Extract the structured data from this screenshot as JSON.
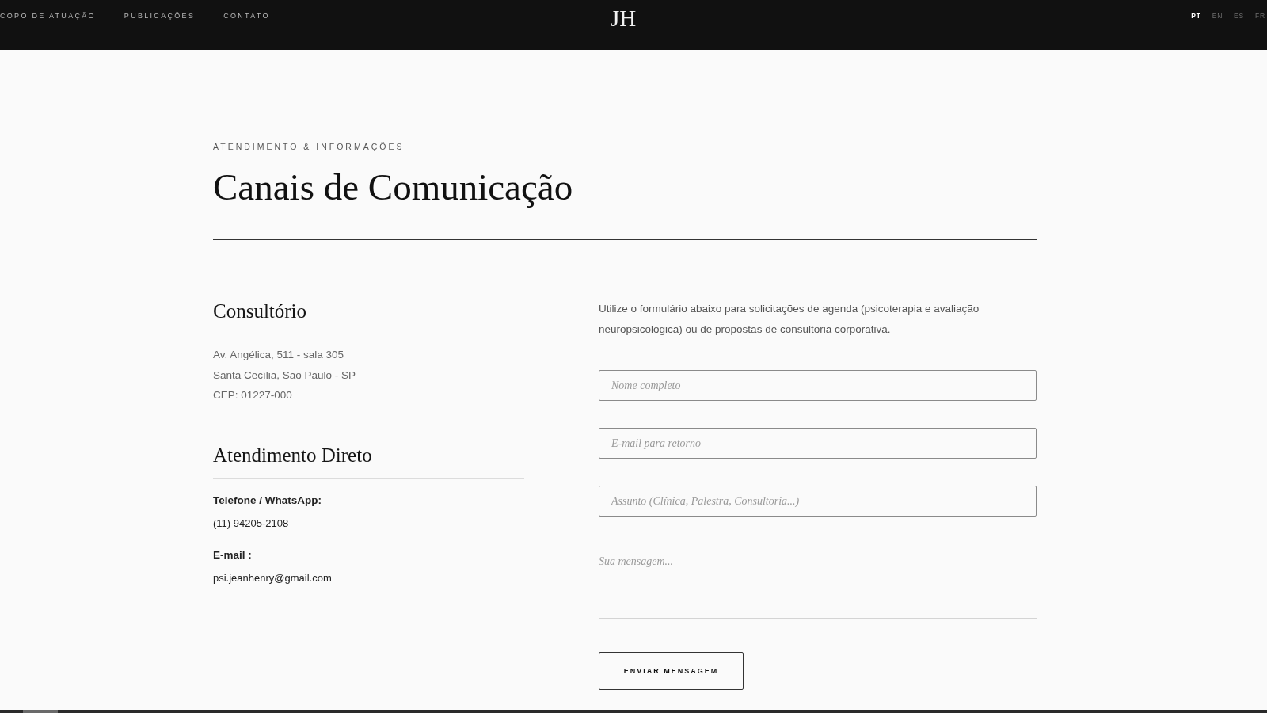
{
  "nav": {
    "links": [
      "COPO DE ATUAÇÃO",
      "PUBLICAÇÕES",
      "CONTATO"
    ],
    "logo": "JH",
    "languages": [
      {
        "label": "PT",
        "selected": true
      },
      {
        "label": "EN",
        "selected": false
      },
      {
        "label": "ES",
        "selected": false
      },
      {
        "label": "FR",
        "selected": false
      }
    ]
  },
  "header": {
    "eyebrow": "ATENDIMENTO & INFORMAÇÕES",
    "title": "Canais de Comunicação"
  },
  "info": {
    "sections": [
      {
        "kind": "address",
        "title": "Consultório",
        "lines": [
          "Av. Angélica, 511 - sala 305",
          "Santa Cecília, São Paulo - SP",
          "CEP: 01227-000"
        ]
      },
      {
        "kind": "contacts",
        "title": "Atendimento Direto",
        "items": [
          {
            "label": "Telefone / WhatsApp:",
            "value": "(11) 94205-2108"
          },
          {
            "label": "E-mail :",
            "value": "psi.jeanhenry@gmail.com"
          }
        ]
      }
    ]
  },
  "form": {
    "intro": "Utilize o formulário abaixo para solicitações de agenda (psicoterapia e avaliação neuropsicológica) ou de propostas de consultoria corporativa.",
    "fields": [
      {
        "kind": "input",
        "placeholder": "Nome completo"
      },
      {
        "kind": "input",
        "placeholder": "E-mail para retorno"
      },
      {
        "kind": "input",
        "placeholder": "Assunto (Clínica, Palestra, Consultoria...)"
      },
      {
        "kind": "textarea",
        "placeholder": "Sua mensagem..."
      }
    ],
    "submit": "ENVIAR MENSAGEM"
  }
}
